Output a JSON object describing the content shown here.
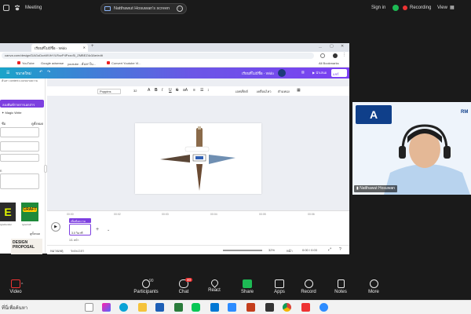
{
  "topbar": {
    "meeting_label": "Meeting",
    "share_label": "Natthawut Hosuwan's screen",
    "signin": "Sign in",
    "recording": "Recording",
    "view": "View"
  },
  "browser": {
    "tab_title": "เรียนที่ไม่มีชื่อ - Wido",
    "url": "canva.com/design/DAGoDoxWVbY/LRvzP4PzzcSi_ZMBEZ4c3Ae/edit",
    "bookmarks": [
      "YouTube",
      "Google adsense",
      "youtube - ค้นหาใน...",
      "Convert Youtube Vi..."
    ],
    "all_bookmarks": "All Bookmarks"
  },
  "canva": {
    "menu_label": "ขนาดใหม่",
    "doc_title": "เรียนที่ไม่มีชื่อ - Wido",
    "share_button": "แชร์",
    "present_button": "นำเสนอ",
    "font_name": "Poppins",
    "font_size": "32",
    "toolbar_items": [
      "เอฟเฟ็กต์",
      "เคลื่อนไหว",
      "ตำแหน่ง"
    ]
  },
  "sidebar": {
    "search_hint": "ค้นหา content แบบขยายความ",
    "purple_button": "ลองพิมพ์รายการเอกสาร",
    "magic_write": "Magic Write",
    "section_label": "ชื่อ",
    "see_all": "ดูทั้งหมด",
    "thumb_left_label": "typebender",
    "thumb_right_label": "typecraft",
    "design_proposal": "DESIGN PROPOSAL",
    "see_all2": "ดูทั้งหมด"
  },
  "timeline": {
    "clip_label": "เพิ่มข้อความ",
    "duration": "3.0 วินาที",
    "ticks": [
      "00:00",
      "00:02",
      "00:03",
      "00:04",
      "00:05",
      "00:06"
    ],
    "page_count": "1/1 หน้า"
  },
  "footer": {
    "notes": "หมายเหตุ",
    "duration": "ระยะเวลา",
    "zoom": "32%",
    "pages": "หน้า",
    "time": "0:00 / 0:03"
  },
  "webcam": {
    "name": "Natthawut Hosuwan",
    "logo_text": "A",
    "corner_text": "RM"
  },
  "controls": {
    "video": "Video",
    "participants": "Participants",
    "participants_count": "90",
    "chat": "Chat",
    "chat_badge": "40",
    "react": "React",
    "share": "Share",
    "apps": "Apps",
    "record": "Record",
    "notes": "Notes",
    "more": "More"
  },
  "taskbar": {
    "search_text": "ที่นี่เพื่อค้นหา"
  },
  "colors": {
    "canva_gradient_start": "#1aa4c9",
    "canva_gradient_end": "#7b3ff2",
    "record_red": "#e33333",
    "share_green": "#1db954"
  }
}
